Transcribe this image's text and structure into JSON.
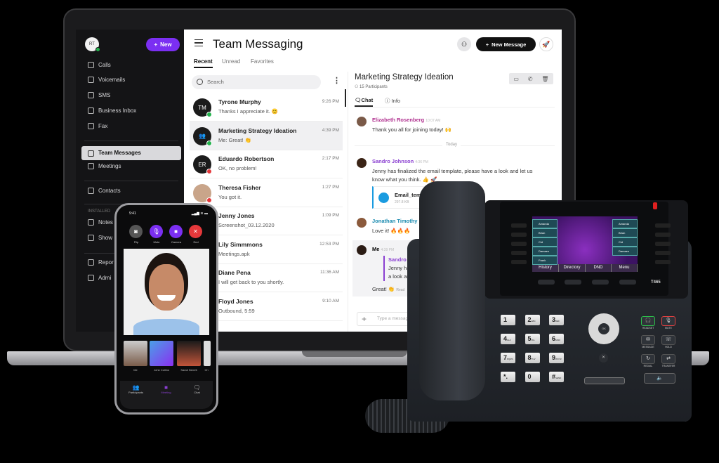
{
  "sidebar": {
    "avatar": "RT",
    "new_button": "New",
    "items": [
      "Calls",
      "Voicemails",
      "SMS",
      "Business Inbox",
      "Fax",
      "Team Messages",
      "Meetings",
      "Contacts"
    ],
    "installed_label": "INSTALLED",
    "installed": [
      "Notes",
      "Show"
    ],
    "admin_items": [
      "Repor",
      "Admi"
    ]
  },
  "header": {
    "title": "Team Messaging",
    "tabs": [
      "Recent",
      "Unread",
      "Favorites"
    ],
    "new_message": "New Message"
  },
  "search": {
    "placeholder": "Search"
  },
  "conversations": [
    {
      "initials": "TM",
      "name": "Tyrone Murphy",
      "preview": "Thanks I appreciate it. 😊",
      "time": "9:26 PM",
      "status": "#22b24c"
    },
    {
      "initials": "👥",
      "name": "Marketing Strategy Ideation",
      "preview": "Me: Great! 👏",
      "time": "4:39 PM",
      "status": "#22b24c"
    },
    {
      "initials": "ER",
      "name": "Eduardo Robertson",
      "preview": "OK, no problem!",
      "time": "2:17 PM",
      "status": "#e5383b"
    },
    {
      "initials": "",
      "name": "Theresa Fisher",
      "preview": "You got it.",
      "time": "1:27 PM",
      "status": "#e5383b"
    },
    {
      "initials": "",
      "name": "Jenny Jones",
      "preview": "Screenshot_03.12.2020",
      "time": "1:09 PM",
      "status": ""
    },
    {
      "initials": "",
      "name": "Lily Simmmons",
      "preview": "Meetings.apk",
      "time": "12:53 PM",
      "status": ""
    },
    {
      "initials": "",
      "name": "Diane Pena",
      "preview": "I will get back to you shortly.",
      "time": "11:36 AM",
      "status": ""
    },
    {
      "initials": "",
      "name": "Floyd Jones",
      "preview": "Outbound, 5:59",
      "time": "9:10 AM",
      "status": ""
    }
  ],
  "chat": {
    "title": "Marketing Strategy Ideation",
    "participants": "15 Participants",
    "tabs": [
      "Chat",
      "Info"
    ],
    "today": "Today",
    "messages": [
      {
        "author": "Elizabeth Rosenberg",
        "time": "10:07 AM",
        "text": "Thank you all for joining today! 🙌",
        "color": "#b0308f"
      },
      {
        "author": "Sandro Johnson",
        "time": "4:36 PM",
        "text": "Jenny has finalized the email template, please have a look and let us know what you think. 👍 🚀",
        "color": "#8a3fd1"
      },
      {
        "author": "Jonathan Timothy",
        "time": "",
        "text": "Love it! 🔥🔥🔥",
        "color": "#1b8bb0"
      },
      {
        "author": "Me",
        "time": "4:39 PM",
        "text": "Great! 👏",
        "color": "#222"
      }
    ],
    "attachment": {
      "name": "Email_templa",
      "size": "297.8 KB"
    },
    "quote": {
      "author": "Sandro Johnson",
      "line1": "Jenny has fi",
      "line2": "a look and le"
    },
    "read": "Read",
    "input_placeholder": "Type a message"
  },
  "mobile": {
    "time": "9:41",
    "buttons": [
      "Flip",
      "Mute",
      "Camera",
      "End"
    ],
    "participants": [
      "Me",
      "John Collins",
      "Sarah Benett",
      "Ch"
    ],
    "nav": [
      "Participants",
      "Meeting",
      "Chat"
    ]
  },
  "deskphone": {
    "model": "T465",
    "softkeys": [
      "History",
      "Directory",
      "DND",
      "Menu"
    ],
    "lines_left": [
      "Amanda",
      "Brian",
      "Cid",
      "Damaen",
      "Frank"
    ],
    "lines_right": [
      "Amanda",
      "Brian",
      "Cid",
      "Damaen"
    ],
    "keys": [
      [
        "1",
        ""
      ],
      [
        "2",
        "ABC"
      ],
      [
        "3",
        "DEF"
      ],
      [
        "4",
        "GHI"
      ],
      [
        "5",
        "JKL"
      ],
      [
        "6",
        "MNO"
      ],
      [
        "7",
        "PQRS"
      ],
      [
        "8",
        "TUV"
      ],
      [
        "9",
        "WXYZ"
      ],
      [
        "*.",
        ""
      ],
      [
        "0",
        ""
      ],
      [
        "#",
        "SEND"
      ]
    ],
    "func_labels": [
      "HEADSET",
      "MUTE",
      "MESSAGE",
      "HOLD",
      "REDIAL",
      "TRANSFER"
    ],
    "ok": "OK"
  },
  "colors": {
    "accent": "#7b2ff2",
    "online": "#22b24c",
    "busy": "#e5383b"
  }
}
